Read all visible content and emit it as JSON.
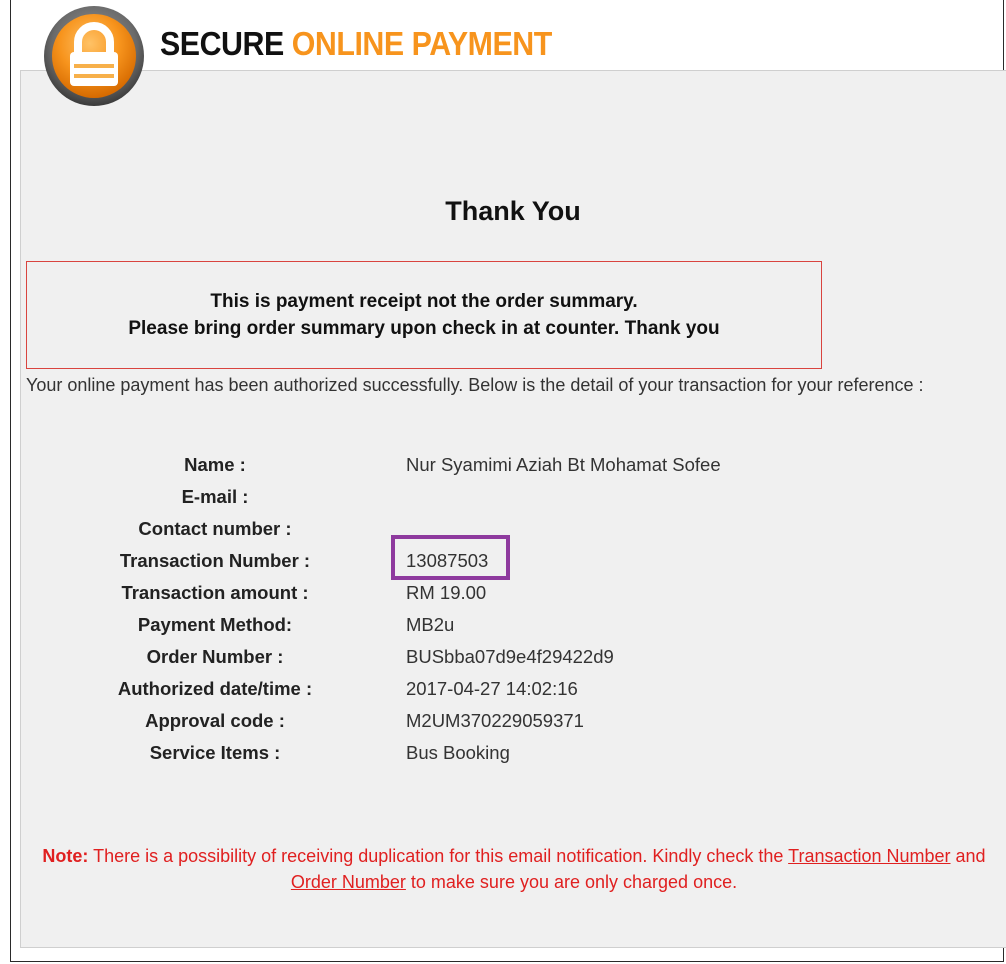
{
  "header": {
    "title_word1": "SECURE",
    "title_word2": "ONLINE PAYMENT",
    "logo_icon": "padlock-icon",
    "accent_color": "#f7941d"
  },
  "heading": "Thank You",
  "receipt_notice": {
    "line1": "This is payment receipt not the order summary.",
    "line2": "Please bring order summary upon check in at counter. Thank you"
  },
  "intro_text": "Your online payment has been authorized successfully. Below is the detail of your transaction for your reference :",
  "details": [
    {
      "label": "Name :",
      "value": "Nur Syamimi Aziah Bt Mohamat Sofee"
    },
    {
      "label": "E-mail :",
      "value": ""
    },
    {
      "label": "Contact number :",
      "value": ""
    },
    {
      "label": "Transaction Number :",
      "value": "13087503"
    },
    {
      "label": "Transaction amount :",
      "value": "RM 19.00"
    },
    {
      "label": "Payment Method:",
      "value": "MB2u"
    },
    {
      "label": "Order Number :",
      "value": "BUSbba07d9e4f29422d9"
    },
    {
      "label": "Authorized date/time :",
      "value": "2017-04-27 14:02:16"
    },
    {
      "label": "Approval code :",
      "value": "M2UM370229059371"
    },
    {
      "label": "Service Items :",
      "value": "Bus Booking"
    }
  ],
  "note": {
    "prefix": "Note:",
    "text_part1": " There is a possibility of receiving duplication for this email notification. Kindly check the ",
    "link1": "Transaction Number",
    "text_part2": " and ",
    "link2": "Order Number",
    "text_part3": " to make sure you are only charged once."
  },
  "colors": {
    "receipt_border": "#d9443f",
    "highlight_border": "#8e3a9e",
    "note_color": "#e02020"
  }
}
